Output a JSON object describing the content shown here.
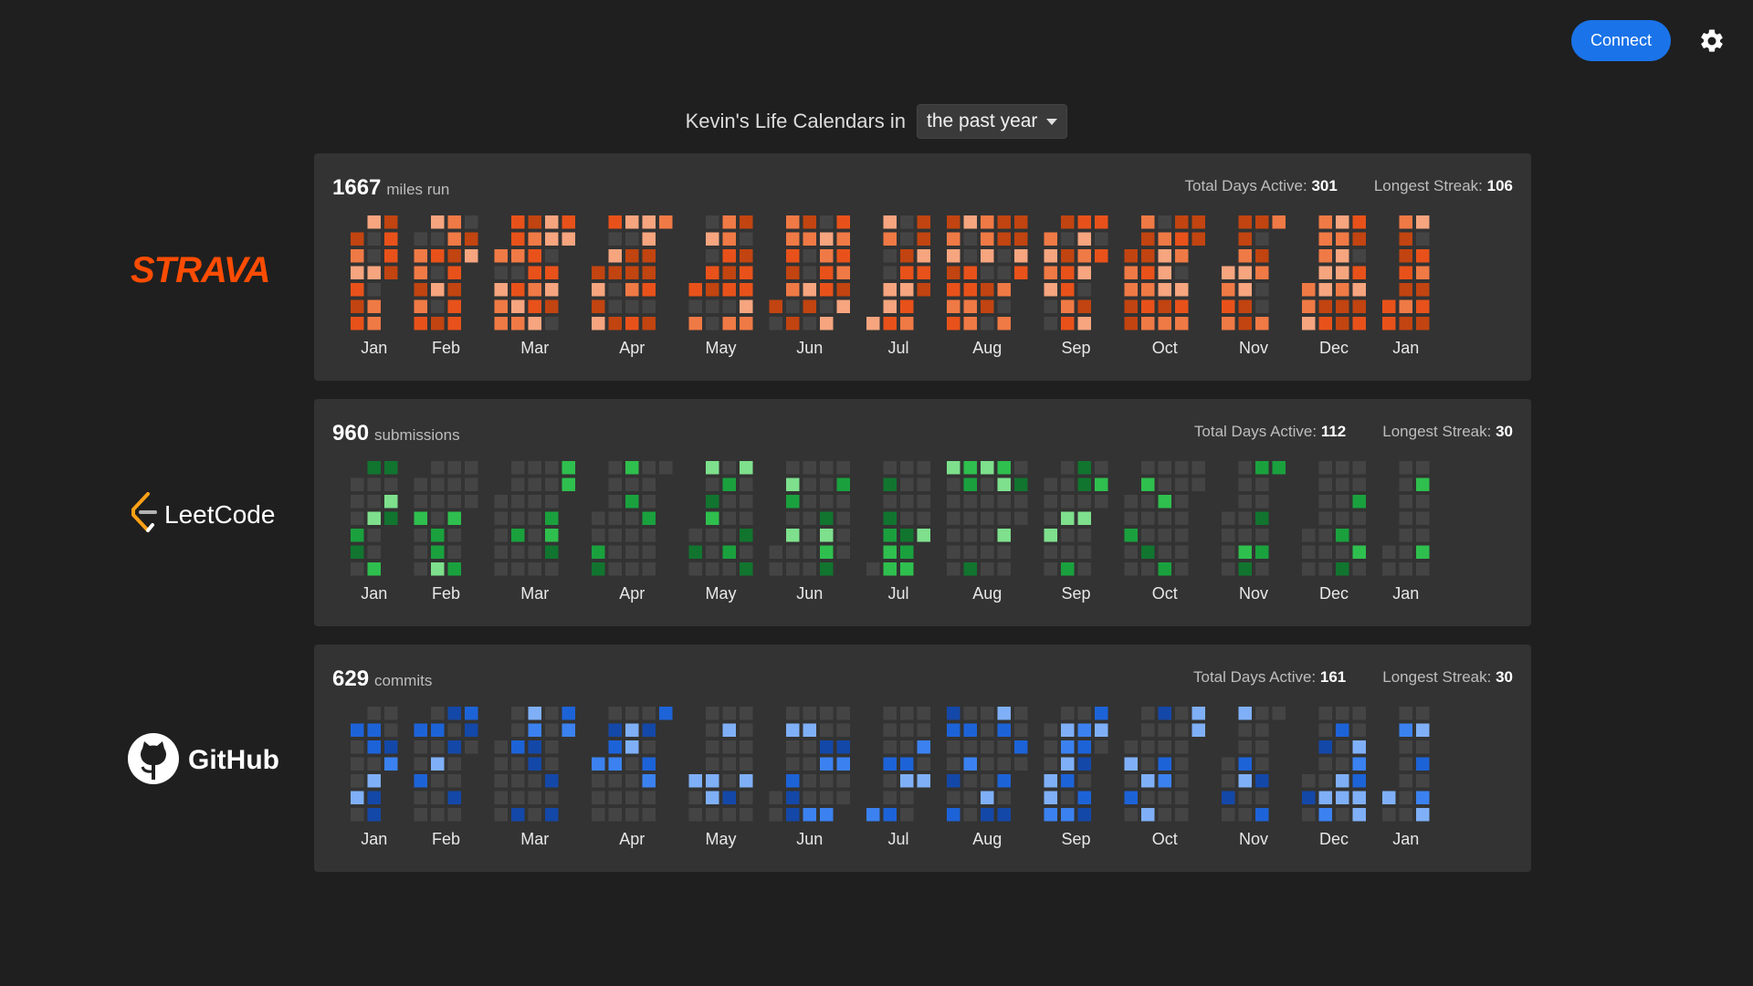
{
  "header": {
    "connect_label": "Connect",
    "settings_icon": "gear-icon"
  },
  "title": {
    "prefix": "Kevin's Life Calendars in",
    "range_selected": "the past year"
  },
  "months": [
    "Jan",
    "Feb",
    "Mar",
    "Apr",
    "May",
    "Jun",
    "Jul",
    "Aug",
    "Sep",
    "Oct",
    "Nov",
    "Dec",
    "Jan"
  ],
  "calendars": [
    {
      "id": "strava",
      "logo_text": "STRAVA",
      "total_value": "1667",
      "total_unit": "miles run",
      "days_label": "Total Days Active:",
      "days_value": "301",
      "streak_label": "Longest Streak:",
      "streak_value": "106",
      "palette": [
        "#444444",
        "#c24410",
        "#e8521a",
        "#f07a45",
        "#f6a57f"
      ],
      "seed": 7,
      "density": 0.82
    },
    {
      "id": "leetcode",
      "logo_text": "LeetCode",
      "total_value": "960",
      "total_unit": "submissions",
      "days_label": "Total Days Active:",
      "days_value": "112",
      "streak_label": "Longest Streak:",
      "streak_value": "30",
      "palette": [
        "#444444",
        "#11752f",
        "#1aa13e",
        "#2fbf4e",
        "#7ee08d"
      ],
      "seed": 3,
      "density": 0.31
    },
    {
      "id": "github",
      "logo_text": "GitHub",
      "total_value": "629",
      "total_unit": "commits",
      "days_label": "Total Days Active:",
      "days_value": "161",
      "streak_label": "Longest Streak:",
      "streak_value": "30",
      "palette": [
        "#444444",
        "#1448a8",
        "#1d63d8",
        "#3b82f0",
        "#7fb0f7"
      ],
      "seed": 11,
      "density": 0.44
    }
  ]
}
